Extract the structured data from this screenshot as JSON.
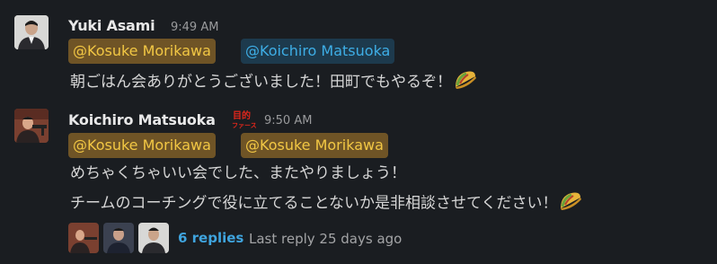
{
  "messages": [
    {
      "author": "Yuki Asami",
      "time": "9:49 AM",
      "mentions": [
        "@Kosuke Morikawa",
        "@Koichiro Matsuoka"
      ],
      "lines": [
        "朝ごはん会ありがとうございました！田町でもやるぞ！"
      ],
      "emoji": "taco-icon"
    },
    {
      "author": "Koichiro Matsuoka",
      "time": "9:50 AM",
      "mentions": [
        "@Kosuke Morikawa",
        "@Kosuke Morikawa"
      ],
      "lines": [
        "めちゃくちゃいい会でした、またやりましょう！",
        "チームのコーチングで役に立てることないか是非相談させてください！"
      ],
      "emoji": "taco-icon",
      "thread": {
        "replies": "6 replies",
        "last_reply": "Last reply 25 days ago"
      }
    }
  ],
  "colors": {
    "background": "#1a1d21",
    "mention_self_bg": "#6f5426",
    "mention_self_text": "#f2c744",
    "mention_other_bg": "#1d3a4d",
    "mention_other_text": "#3eaee6",
    "link": "#3fa4de"
  }
}
